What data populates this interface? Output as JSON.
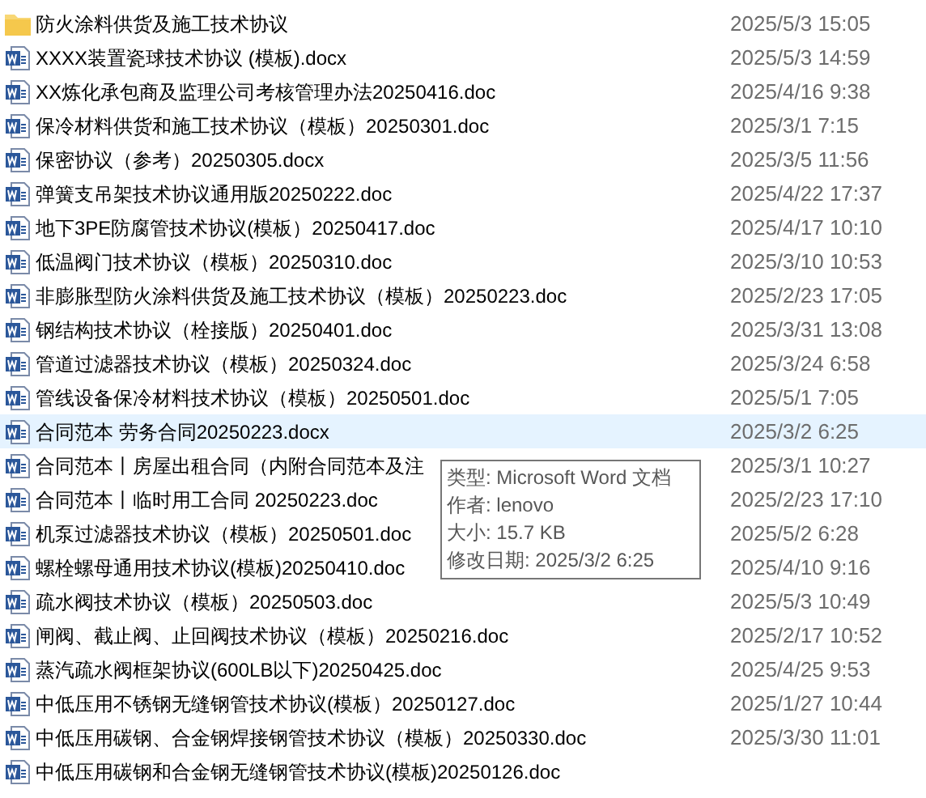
{
  "files": [
    {
      "kind": "folder",
      "name": "防火涂料供货及施工技术协议",
      "modified": "2025/5/3 15:05",
      "selected": false
    },
    {
      "kind": "word",
      "name": "XXXX装置瓷球技术协议 (模板).docx",
      "modified": "2025/5/3 14:59",
      "selected": false
    },
    {
      "kind": "word",
      "name": "XX炼化承包商及监理公司考核管理办法20250416.doc",
      "modified": "2025/4/16 9:38",
      "selected": false
    },
    {
      "kind": "word",
      "name": "保冷材料供货和施工技术协议（模板）20250301.doc",
      "modified": "2025/3/1 7:15",
      "selected": false
    },
    {
      "kind": "word",
      "name": "保密协议（参考）20250305.docx",
      "modified": "2025/3/5 11:56",
      "selected": false
    },
    {
      "kind": "word",
      "name": "弹簧支吊架技术协议通用版20250222.doc",
      "modified": "2025/4/22 17:37",
      "selected": false
    },
    {
      "kind": "word",
      "name": "地下3PE防腐管技术协议(模板）20250417.doc",
      "modified": "2025/4/17 10:10",
      "selected": false
    },
    {
      "kind": "word",
      "name": "低温阀门技术协议（模板）20250310.doc",
      "modified": "2025/3/10 10:53",
      "selected": false
    },
    {
      "kind": "word",
      "name": "非膨胀型防火涂料供货及施工技术协议（模板）20250223.doc",
      "modified": "2025/2/23 17:05",
      "selected": false
    },
    {
      "kind": "word",
      "name": "钢结构技术协议（栓接版）20250401.doc",
      "modified": "2025/3/31 13:08",
      "selected": false
    },
    {
      "kind": "word",
      "name": "管道过滤器技术协议（模板）20250324.doc",
      "modified": "2025/3/24 6:58",
      "selected": false
    },
    {
      "kind": "word",
      "name": "管线设备保冷材料技术协议（模板）20250501.doc",
      "modified": "2025/5/1 7:05",
      "selected": false
    },
    {
      "kind": "word",
      "name": "合同范本 劳务合同20250223.docx",
      "modified": "2025/3/2 6:25",
      "selected": true
    },
    {
      "kind": "word",
      "name": "合同范本丨房屋出租合同（内附合同范本及注",
      "modified": "2025/3/1 10:27",
      "selected": false
    },
    {
      "kind": "word",
      "name": "合同范本丨临时用工合同  20250223.doc",
      "modified": "2025/2/23 17:10",
      "selected": false
    },
    {
      "kind": "word",
      "name": "机泵过滤器技术协议（模板）20250501.doc",
      "modified": "2025/5/2 6:28",
      "selected": false
    },
    {
      "kind": "word",
      "name": "螺栓螺母通用技术协议(模板)20250410.doc",
      "modified": "2025/4/10 9:16",
      "selected": false
    },
    {
      "kind": "word",
      "name": "疏水阀技术协议（模板）20250503.doc",
      "modified": "2025/5/3 10:49",
      "selected": false
    },
    {
      "kind": "word",
      "name": "闸阀、截止阀、止回阀技术协议（模板）20250216.doc",
      "modified": "2025/2/17 10:52",
      "selected": false
    },
    {
      "kind": "word",
      "name": "蒸汽疏水阀框架协议(600LB以下)20250425.doc",
      "modified": "2025/4/25 9:53",
      "selected": false
    },
    {
      "kind": "word",
      "name": "中低压用不锈钢无缝钢管技术协议(模板）20250127.doc",
      "modified": "2025/1/27 10:44",
      "selected": false
    },
    {
      "kind": "word",
      "name": "中低压用碳钢、合金钢焊接钢管技术协议（模板）20250330.doc",
      "modified": "2025/3/30 11:01",
      "selected": false
    },
    {
      "kind": "word",
      "name": "中低压用碳钢和合金钢无缝钢管技术协议(模板)20250126.doc",
      "selected": false
    }
  ],
  "tooltip": [
    "类型: Microsoft Word 文档",
    "作者: lenovo",
    "大小: 15.7 KB",
    "修改日期: 2025/3/2 6:25"
  ]
}
